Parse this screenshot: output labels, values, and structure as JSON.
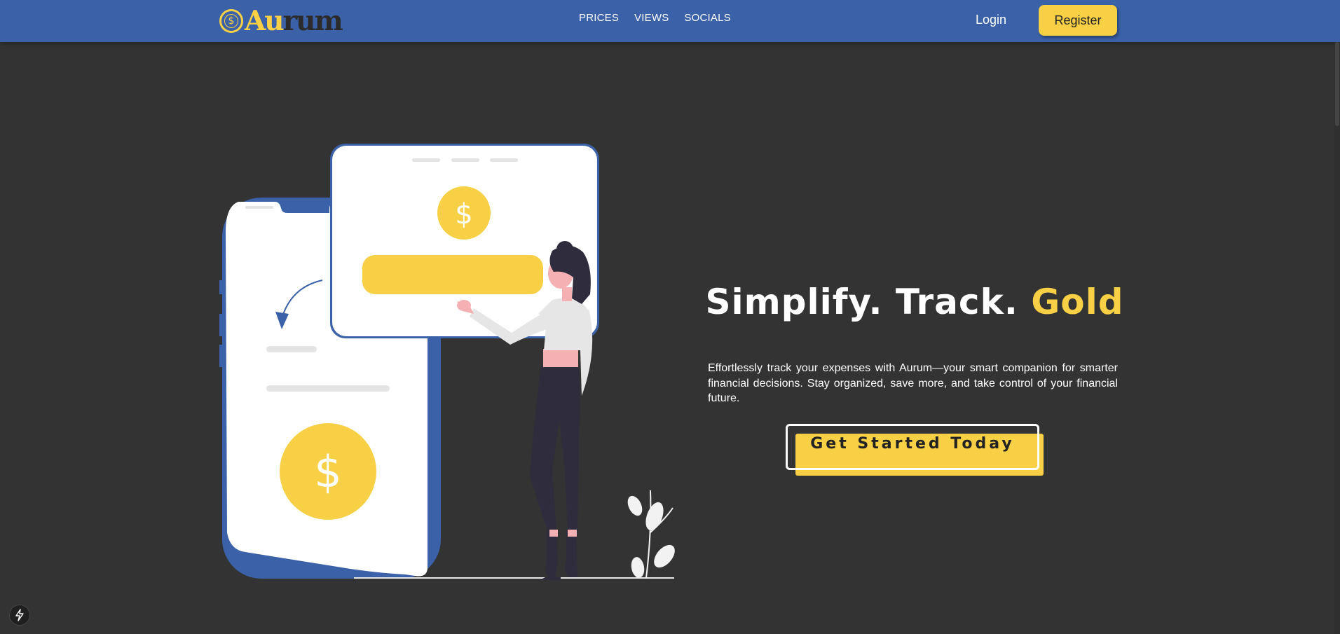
{
  "brand": {
    "au": "Au",
    "rum": "rum",
    "coin_glyph": "$"
  },
  "nav": {
    "links": [
      "PRICES",
      "VIEWS",
      "SOCIALS"
    ]
  },
  "auth": {
    "login": "Login",
    "register": "Register"
  },
  "hero": {
    "title_part": "Simplify. Track. ",
    "title_gold": "Gold",
    "description": "Effortlessly track your expenses with Aurum—your smart companion for smarter financial decisions. Stay organized, save more, and take control of your financial future.",
    "cta": "Get Started Today"
  },
  "illustration": {
    "coin_symbol": "$"
  },
  "icons": {
    "badge": "lightning-icon",
    "arrow": "curved-arrow-icon",
    "plant": "plant-icon"
  },
  "colors": {
    "nav": "#3b62a8",
    "accent": "#f8d046",
    "background": "#333333"
  }
}
